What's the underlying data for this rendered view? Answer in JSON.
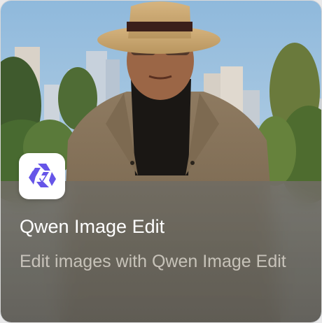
{
  "card": {
    "title": "Qwen Image Edit",
    "description": "Edit images with Qwen Image Edit",
    "icon": "qwen-logo-icon",
    "thumbnail": "man-in-hat-city-photo"
  },
  "colors": {
    "logo_purple": "#6655e8",
    "overlay": "#6b675e",
    "title": "#ffffff",
    "description": "#d8d4ca"
  }
}
